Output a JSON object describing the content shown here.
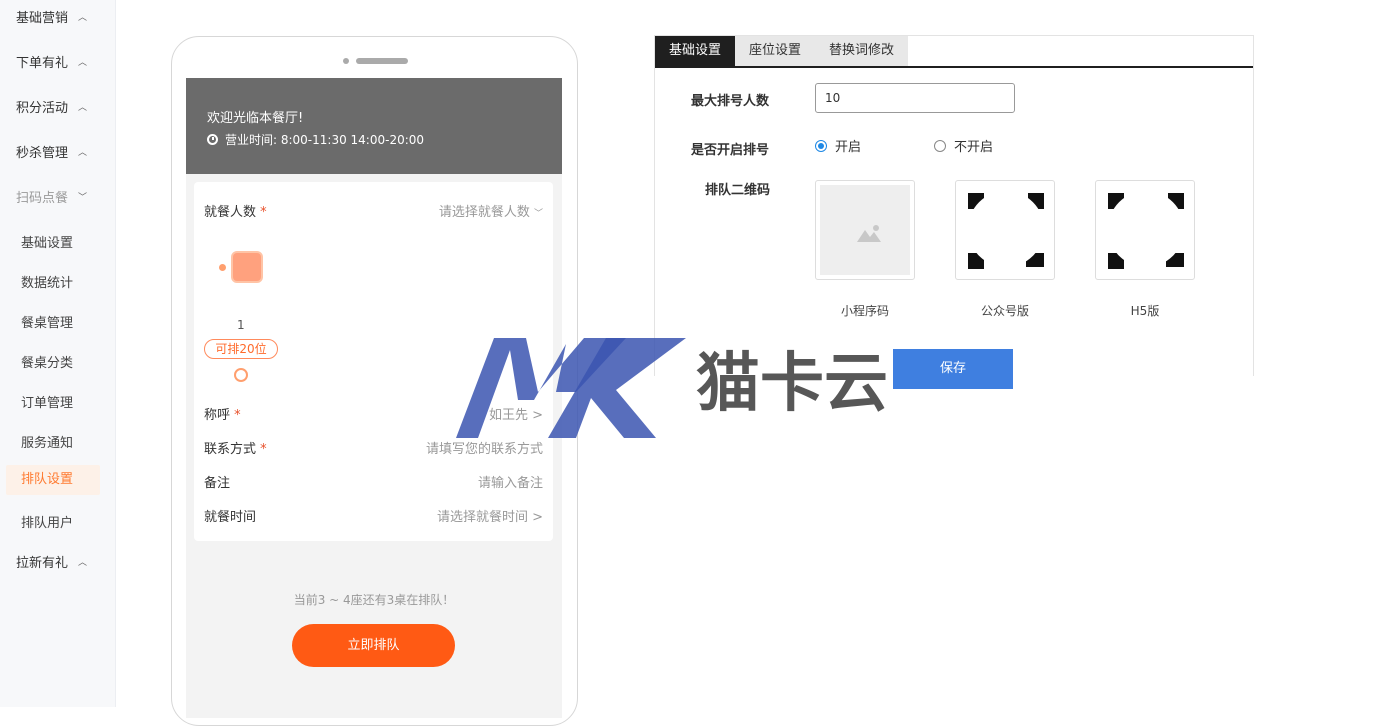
{
  "sidebar": {
    "groups_top": [
      {
        "label": "基础营销"
      },
      {
        "label": "下单有礼"
      },
      {
        "label": "积分活动"
      },
      {
        "label": "秒杀管理"
      },
      {
        "label": "扫码点餐"
      }
    ],
    "sub_items": [
      {
        "label": "基础设置"
      },
      {
        "label": "数据统计"
      },
      {
        "label": "餐桌管理"
      },
      {
        "label": "餐桌分类"
      },
      {
        "label": "订单管理"
      },
      {
        "label": "服务通知"
      },
      {
        "label": "排队设置"
      },
      {
        "label": "排队用户"
      }
    ],
    "group_bottom": {
      "label": "拉新有礼"
    },
    "active_item": "排队设置"
  },
  "phone": {
    "welcome": "欢迎光临本餐厅!",
    "hours": "营业时间: 8:00-11:30 14:00-20:00",
    "diners_label": "就餐人数",
    "diners_value": "请选择就餐人数",
    "seat_number": "1",
    "seat_badge": "可排20位",
    "name_label": "称呼",
    "name_value": "如王先 >",
    "contact_label": "联系方式",
    "contact_value": "请填写您的联系方式",
    "remark_label": "备注",
    "remark_value": "请输入备注",
    "time_label": "就餐时间",
    "time_value": "请选择就餐时间 >",
    "required_mark": "*",
    "queue_info": "当前3 ~ 4座还有3桌在排队！",
    "queue_button": "立即排队"
  },
  "settings": {
    "tabs": [
      {
        "label": "基础设置",
        "active": true
      },
      {
        "label": "座位设置",
        "active": false
      },
      {
        "label": "替换词修改",
        "active": false
      }
    ],
    "max_queue_label": "最大排号人数",
    "max_queue_value": "10",
    "enable_label": "是否开启排号",
    "enable_on": "开启",
    "enable_off": "不开启",
    "qr_label": "排队二维码",
    "qr_items": [
      {
        "caption": "小程序码"
      },
      {
        "caption": "公众号版"
      },
      {
        "caption": "H5版"
      }
    ],
    "save_button": "保存"
  },
  "watermark": {
    "logo_text": "猫卡云"
  },
  "colors": {
    "accent_orange": "#ff5a14",
    "save_blue": "#3f7fe0",
    "radio_blue": "#1e88e5",
    "banner_gray": "#6b6b6b",
    "tab_active": "#1f1f1f"
  }
}
